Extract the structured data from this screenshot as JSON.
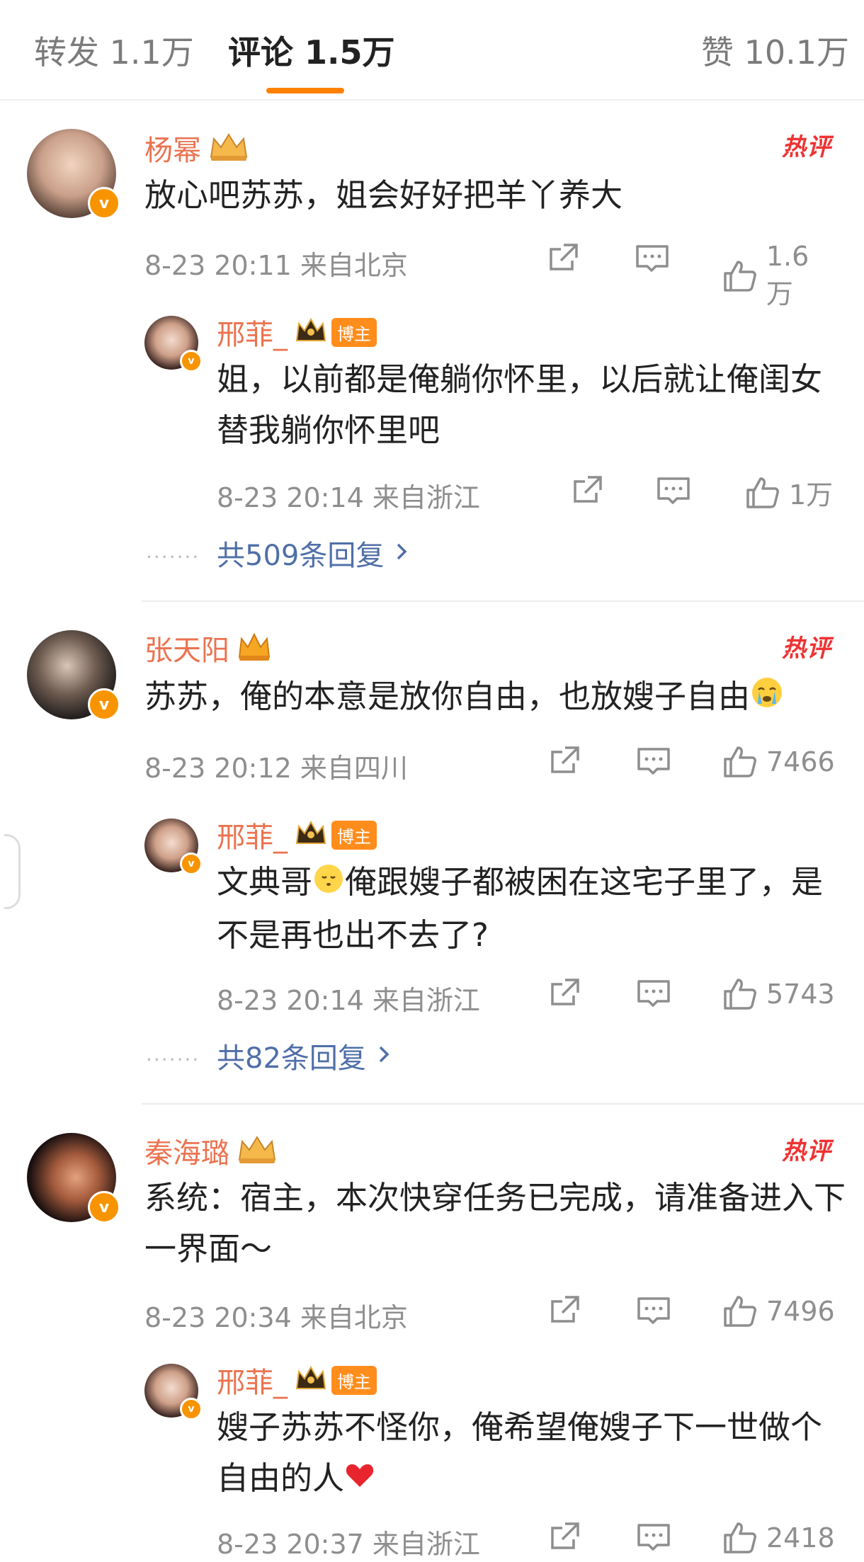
{
  "tabs": [
    {
      "label": "转发 1.1万"
    },
    {
      "label": "评论 1.5万"
    },
    {
      "label": "赞 10.1万"
    }
  ],
  "hot_label": "热评",
  "colors": {
    "accent": "#ff8200",
    "username": "#eb7350",
    "link": "#4f6fa8",
    "verified": "#f79400"
  },
  "comments": [
    {
      "user": "杨幂",
      "text": "放心吧苏苏，姐会好好把羊丫养大",
      "meta": "8-23 20:11  来自北京",
      "likes": "1.6万",
      "reply": {
        "user": "邢菲_",
        "badge": "博主",
        "text": "姐，以前都是俺躺你怀里，以后就让俺闺女替我躺你怀里吧",
        "meta": "8-23 20:14  来自浙江",
        "likes": "1万"
      },
      "more": "共509条回复"
    },
    {
      "user": "张天阳",
      "text": "苏苏，俺的本意是放你自由，也放嫂子自由",
      "meta": "8-23 20:12  来自四川",
      "likes": "7466",
      "reply": {
        "user": "邢菲_",
        "badge": "博主",
        "text_a": "文典哥",
        "text_b": "俺跟嫂子都被困在这宅子里了，是不是再也出不去了?",
        "meta": "8-23 20:14  来自浙江",
        "likes": "5743"
      },
      "more": "共82条回复"
    },
    {
      "user": "秦海璐",
      "text": "系统：宿主，本次快穿任务已完成，请准备进入下一界面～",
      "meta": "8-23 20:34  来自北京",
      "likes": "7496",
      "reply": {
        "user": "邢菲_",
        "badge": "博主",
        "text": "嫂子苏苏不怪你，俺希望俺嫂子下一世做个自由的人",
        "meta": "8-23 20:37  来自浙江",
        "likes": "2418"
      }
    }
  ]
}
